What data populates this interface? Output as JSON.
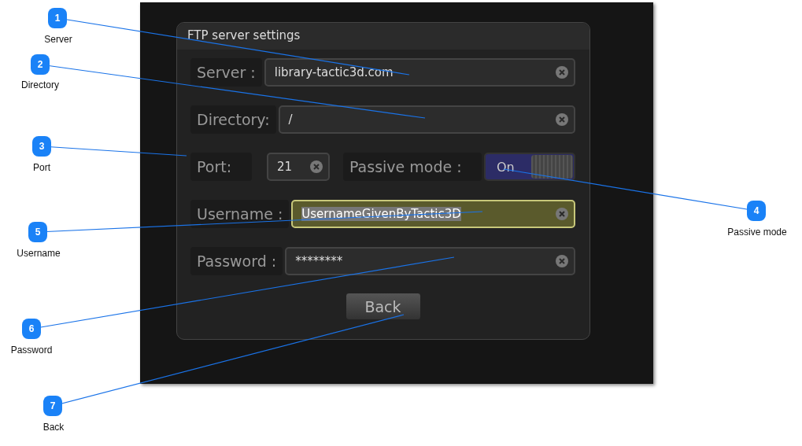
{
  "dialog": {
    "title": "FTP server settings",
    "rows": [
      {
        "kind": "text",
        "label": "Server :",
        "value": "library-tactic3d.com",
        "focused": false
      },
      {
        "kind": "text",
        "label": "Directory:",
        "value": "/",
        "focused": false
      },
      {
        "kind": "port",
        "label": "Port:",
        "value": "21",
        "toggle_label": "Passive mode :",
        "toggle_text": "On",
        "on": true
      },
      {
        "kind": "text",
        "label": "Username :",
        "value": "UsernameGivenByTactic3D",
        "focused": true
      },
      {
        "kind": "text",
        "label": "Password :",
        "value": "********",
        "focused": false
      }
    ],
    "button": "Back"
  },
  "callouts": [
    {
      "number": "1",
      "label": "Server"
    },
    {
      "number": "2",
      "label": "Directory"
    },
    {
      "number": "3",
      "label": "Port"
    },
    {
      "number": "4",
      "label": "Passive mode"
    },
    {
      "number": "5",
      "label": "Username"
    },
    {
      "number": "6",
      "label": "Password"
    },
    {
      "number": "7",
      "label": "Back"
    }
  ]
}
